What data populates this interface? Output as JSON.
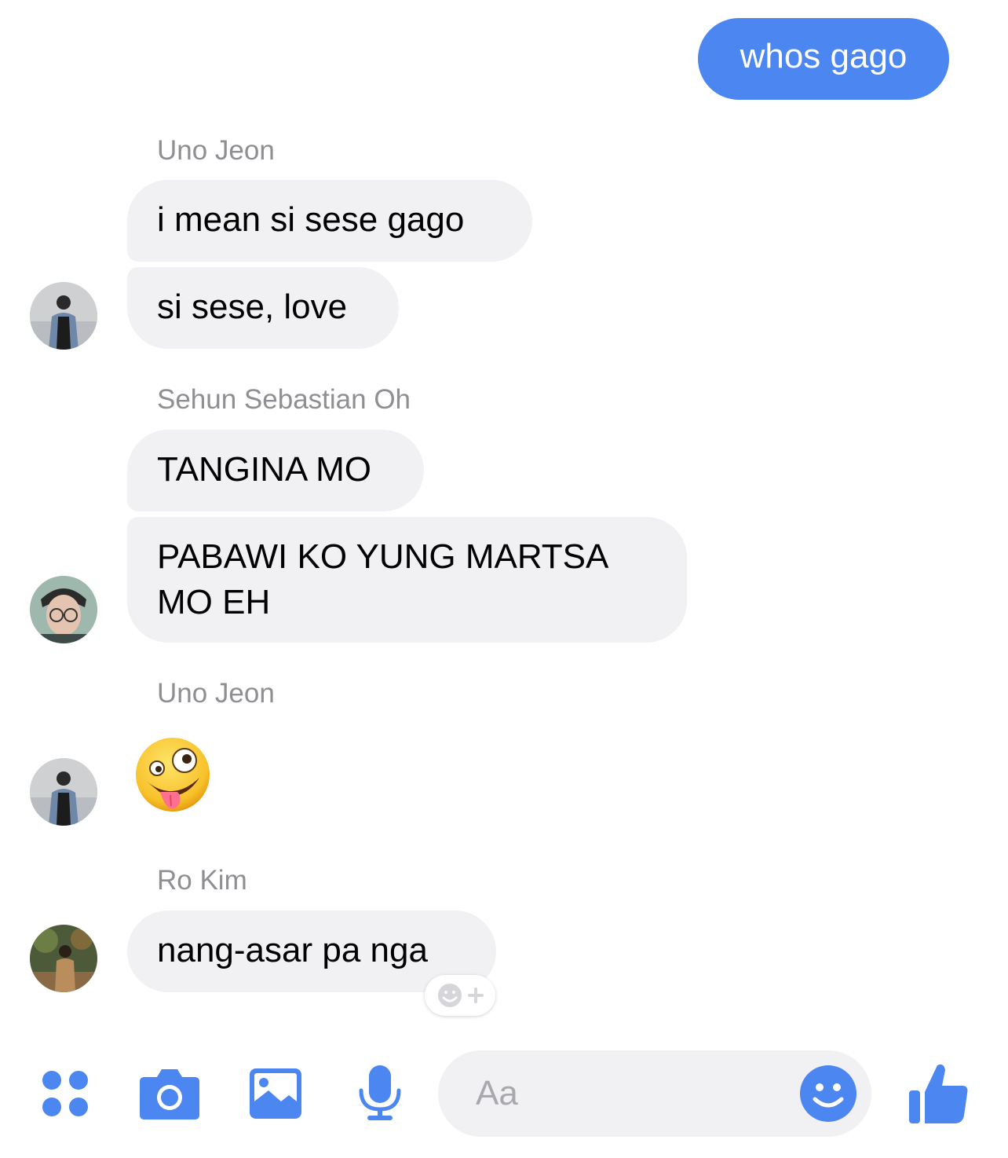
{
  "conversation": {
    "outgoing": [
      {
        "text": "whos gago"
      }
    ],
    "groups": [
      {
        "sender": "Uno Jeon",
        "messages": [
          "i mean si sese gago",
          "si sese, love"
        ]
      },
      {
        "sender": "Sehun Sebastian Oh",
        "messages": [
          "TANGINA MO",
          "PABAWI KO YUNG MARTSA",
          "MO EH"
        ]
      },
      {
        "sender": "Uno Jeon",
        "emoji": "zany-face-emoji"
      },
      {
        "sender": "Ro Kim",
        "messages": [
          "nang-asar pa nga"
        ],
        "reaction_button": "add-reaction-icon"
      }
    ]
  },
  "composer": {
    "placeholder": "Aa",
    "icons": [
      "more-apps-icon",
      "camera-icon",
      "gallery-icon",
      "microphone-icon",
      "emoji-icon",
      "thumbs-up-icon"
    ]
  },
  "colors": {
    "accent": "#4c86f0",
    "incoming_bubble": "#f1f1f3",
    "sender_label": "#8e8e93",
    "placeholder": "#a8a8ad"
  }
}
